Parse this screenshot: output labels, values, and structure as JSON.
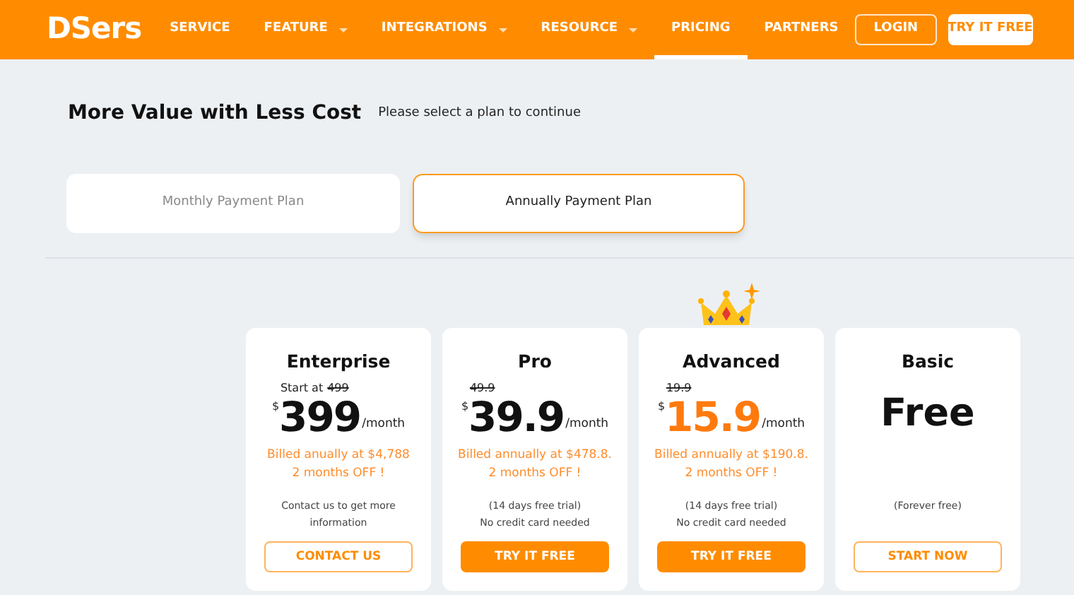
{
  "header": {
    "logo": "DSers",
    "nav": [
      {
        "label": "SERVICE",
        "has_menu": false,
        "selected": false
      },
      {
        "label": "FEATURE",
        "has_menu": true,
        "selected": false
      },
      {
        "label": "INTEGRATIONS",
        "has_menu": true,
        "selected": false
      },
      {
        "label": "RESOURCE",
        "has_menu": true,
        "selected": false
      },
      {
        "label": "PRICING",
        "has_menu": false,
        "selected": true
      },
      {
        "label": "PARTNERS",
        "has_menu": false,
        "selected": false
      }
    ],
    "login": "LOGIN",
    "try_free": "TRY IT FREE"
  },
  "heading": "More Value with Less Cost",
  "subheading": "Please select a plan to continue",
  "tabs": [
    {
      "label": "Monthly Payment Plan",
      "selected": false
    },
    {
      "label": "Annually Payment Plan",
      "selected": true
    }
  ],
  "plans": [
    {
      "name": "Enterprise",
      "featured": false,
      "old_prefix": "Start at",
      "old_price": "499",
      "currency": "$",
      "price": "399",
      "period": "/month",
      "billed": [
        "Billed anually at $4,788",
        "2 months OFF !"
      ],
      "note": [
        "Contact us to get more",
        "information"
      ],
      "button": {
        "label": "CONTACT US",
        "kind": "outline"
      }
    },
    {
      "name": "Pro",
      "featured": false,
      "old_price": "49.9",
      "currency": "$",
      "price": "39.9",
      "period": "/month",
      "billed": [
        "Billed annually at $478.8.",
        "2 months OFF !"
      ],
      "note": [
        "(14 days free trial)",
        "No credit card needed"
      ],
      "button": {
        "label": "TRY IT FREE",
        "kind": "filled"
      }
    },
    {
      "name": "Advanced",
      "featured": true,
      "old_price": "19.9",
      "currency": "$",
      "price": "15.9",
      "period": "/month",
      "billed": [
        "Billed annually at $190.8.",
        "2 months OFF !"
      ],
      "note": [
        "(14 days free trial)",
        "No credit card needed"
      ],
      "button": {
        "label": "TRY IT FREE",
        "kind": "filled"
      }
    },
    {
      "name": "Basic",
      "featured": false,
      "price": "Free",
      "note": [
        "(Forever free)"
      ],
      "button": {
        "label": "START NOW",
        "kind": "outline"
      }
    }
  ]
}
